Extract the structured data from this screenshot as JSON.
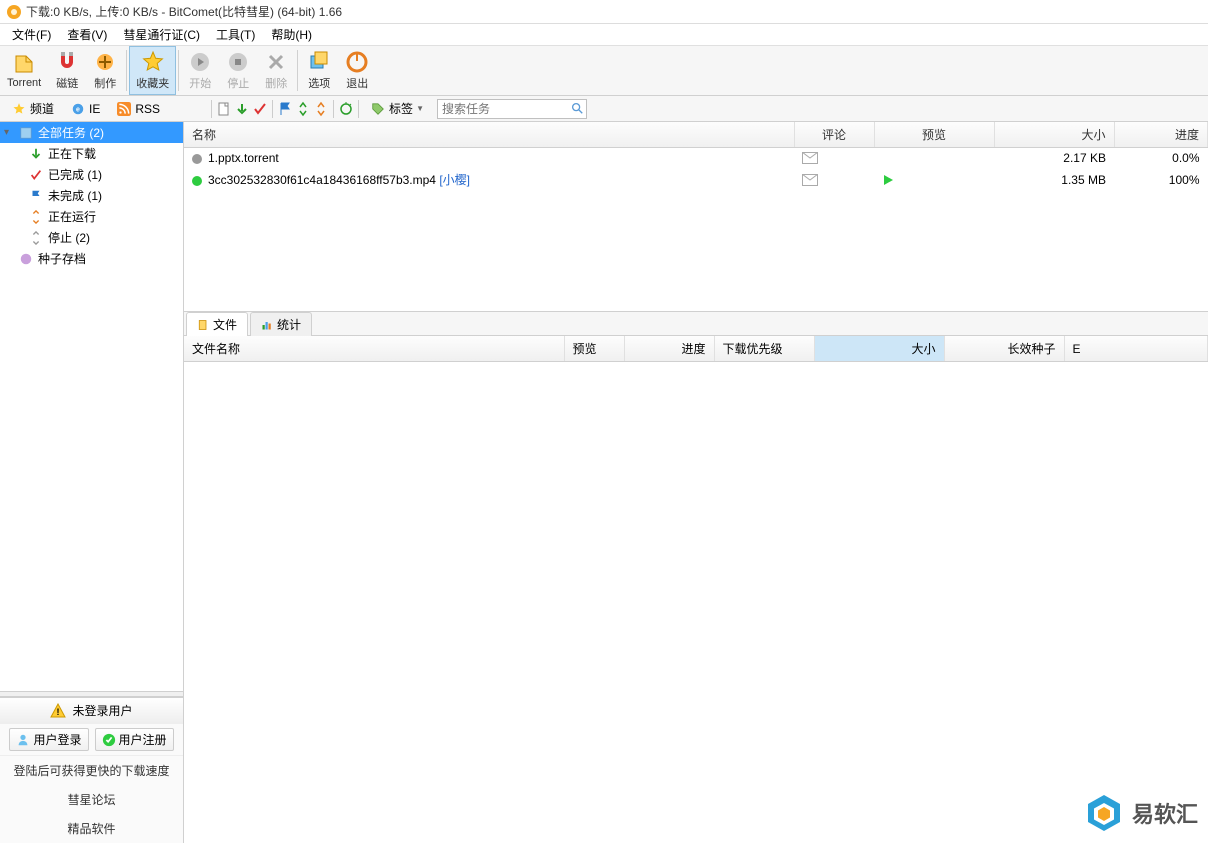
{
  "title": "下载:0 KB/s, 上传:0 KB/s - BitComet(比特彗星) (64-bit) 1.66",
  "menu": {
    "file": "文件(F)",
    "view": "查看(V)",
    "passport": "彗星通行证(C)",
    "tools": "工具(T)",
    "help": "帮助(H)"
  },
  "toolbar": {
    "torrent": "Torrent",
    "magnet": "磁链",
    "make": "制作",
    "favorites": "收藏夹",
    "start": "开始",
    "stop": "停止",
    "delete": "删除",
    "options": "选项",
    "exit": "退出"
  },
  "sec": {
    "channel": "频道",
    "ie": "IE",
    "rss": "RSS",
    "tags": "标签"
  },
  "search": {
    "placeholder": "搜索任务"
  },
  "tree": {
    "all": "全部任务 (2)",
    "downloading": "正在下载",
    "finished": "已完成 (1)",
    "unfinished": "未完成 (1)",
    "running": "正在运行",
    "stopped": "停止 (2)",
    "archive": "种子存档"
  },
  "user": {
    "not_logged": "未登录用户",
    "login": "用户登录",
    "register": "用户注册",
    "tip": "登陆后可获得更快的下载速度",
    "forum": "彗星论坛",
    "soft": "精品软件"
  },
  "task_cols": {
    "name": "名称",
    "comment": "评论",
    "preview": "预览",
    "size": "大小",
    "progress": "进度"
  },
  "tasks": [
    {
      "status": "gray",
      "name": "1.pptx.torrent",
      "tag": "",
      "comment": "mail",
      "preview": "",
      "size": "2.17 KB",
      "progress": "0.0%"
    },
    {
      "status": "green",
      "name": "3cc302532830f61c4a18436168ff57b3.mp4",
      "tag": "[小樱]",
      "comment": "mail",
      "preview": "play",
      "size": "1.35 MB",
      "progress": "100%"
    }
  ],
  "btabs": {
    "files": "文件",
    "stats": "统计"
  },
  "detail_cols": {
    "fname": "文件名称",
    "preview": "预览",
    "progress": "进度",
    "priority": "下载优先级",
    "size": "大小",
    "seed": "长效种子",
    "e": "E"
  },
  "watermark": "易软汇"
}
